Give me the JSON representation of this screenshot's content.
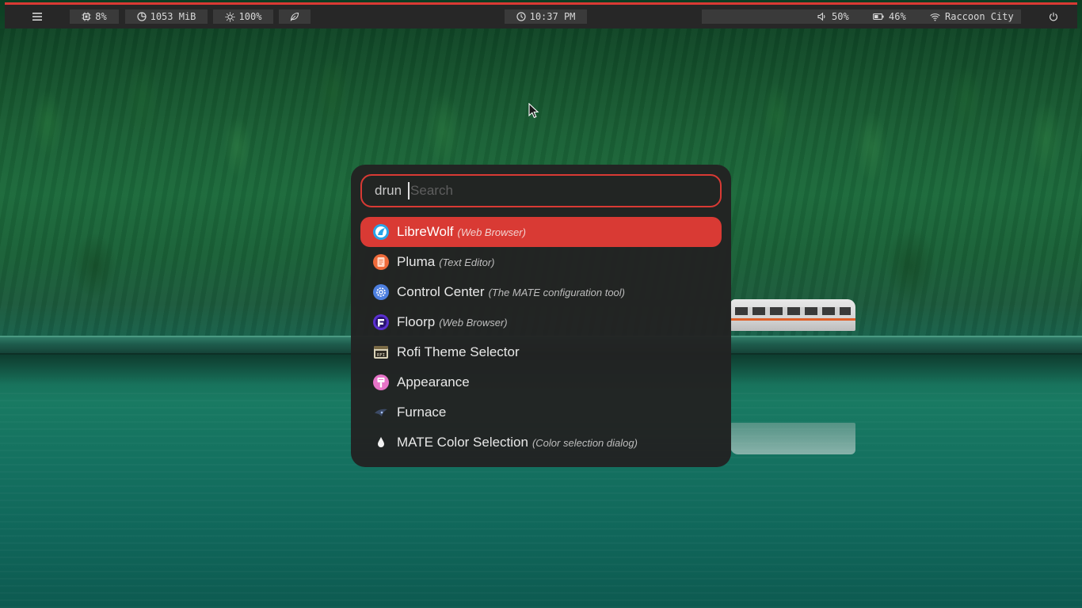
{
  "topbar": {
    "menu_icon": "hamburger-menu-icon",
    "cpu": "8%",
    "memory": "1053 MiB",
    "brightness": "100%",
    "clock": "10:37 PM",
    "volume": "50%",
    "battery": "46%",
    "wifi": "Raccoon City",
    "accent_color": "#d93a34"
  },
  "launcher": {
    "prompt": "drun",
    "search_value": "",
    "search_placeholder": "Search",
    "accent_color": "#d93a34",
    "items": [
      {
        "name": "LibreWolf",
        "desc": "(Web Browser)",
        "icon": "librewolf-icon",
        "selected": true
      },
      {
        "name": "Pluma",
        "desc": "(Text Editor)",
        "icon": "pluma-icon"
      },
      {
        "name": "Control Center",
        "desc": "(The MATE configuration tool)",
        "icon": "control-center-icon"
      },
      {
        "name": "Floorp",
        "desc": "(Web Browser)",
        "icon": "floorp-icon"
      },
      {
        "name": "Rofi Theme Selector",
        "desc": "",
        "icon": "rofi-theme-icon"
      },
      {
        "name": "Appearance",
        "desc": "",
        "icon": "appearance-icon"
      },
      {
        "name": "Furnace",
        "desc": "",
        "icon": "furnace-icon"
      },
      {
        "name": "MATE Color Selection",
        "desc": "(Color selection dialog)",
        "icon": "color-drop-icon"
      }
    ]
  }
}
